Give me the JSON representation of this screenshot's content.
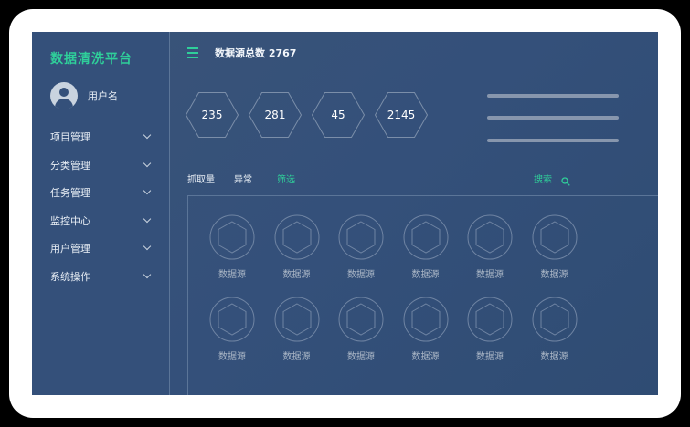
{
  "sidebar": {
    "brand": "数据清洗平台",
    "username": "用户名",
    "items": [
      {
        "label": "项目管理"
      },
      {
        "label": "分类管理"
      },
      {
        "label": "任务管理"
      },
      {
        "label": "监控中心"
      },
      {
        "label": "用户管理"
      },
      {
        "label": "系统操作"
      }
    ]
  },
  "header": {
    "title": "数据源总数 2767"
  },
  "stats": [
    {
      "value": "235"
    },
    {
      "value": "281"
    },
    {
      "value": "45"
    },
    {
      "value": "2145"
    }
  ],
  "filters": [
    {
      "label": "抓取量",
      "active": false
    },
    {
      "label": "异常",
      "active": false
    },
    {
      "label": "筛选",
      "active": true
    }
  ],
  "search": {
    "label": "搜索"
  },
  "grid": {
    "tiles": [
      {
        "label": "数据源"
      },
      {
        "label": "数据源"
      },
      {
        "label": "数据源"
      },
      {
        "label": "数据源"
      },
      {
        "label": "数据源"
      },
      {
        "label": "数据源"
      },
      {
        "label": "数据源"
      },
      {
        "label": "数据源"
      },
      {
        "label": "数据源"
      },
      {
        "label": "数据源"
      },
      {
        "label": "数据源"
      },
      {
        "label": "数据源"
      }
    ]
  },
  "colors": {
    "accent": "#2fcf9a",
    "background": "#34507a",
    "text": "#e8eef5"
  },
  "icons": {
    "menu": "hamburger-icon",
    "search": "search-icon",
    "chevron": "chevron-down-icon",
    "avatar": "avatar-icon"
  }
}
